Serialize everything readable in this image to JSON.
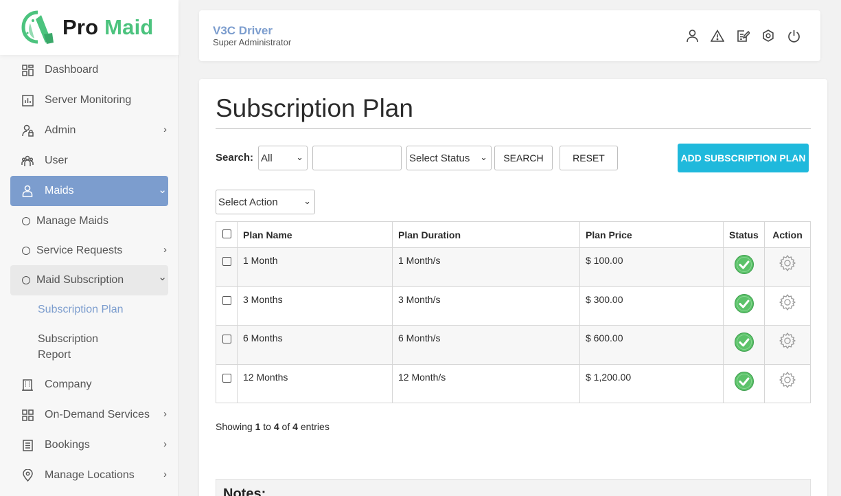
{
  "brand": {
    "word1": "Pro",
    "word2": "Maid"
  },
  "sidebar": {
    "items": [
      {
        "label": "Dashboard"
      },
      {
        "label": "Server Monitoring"
      },
      {
        "label": "Admin"
      },
      {
        "label": "User"
      },
      {
        "label": "Maids"
      },
      {
        "label": "Manage Maids"
      },
      {
        "label": "Service Requests"
      },
      {
        "label": "Maid Subscription"
      },
      {
        "label": "Subscription Plan"
      },
      {
        "label": "Subscription"
      },
      {
        "label": "Report"
      },
      {
        "label": "Company"
      },
      {
        "label": "On-Demand Services"
      },
      {
        "label": "Bookings"
      },
      {
        "label": "Manage Locations"
      }
    ]
  },
  "header": {
    "name": "V3C Driver",
    "role": "Super Administrator"
  },
  "page": {
    "title": "Subscription Plan"
  },
  "filters": {
    "search_label": "Search:",
    "field_select": "All",
    "search_value": "",
    "status_select": "Select Status",
    "search_button": "SEARCH",
    "reset_button": "RESET",
    "add_button": "ADD SUBSCRIPTION PLAN",
    "action_select": "Select Action"
  },
  "table": {
    "headers": [
      "Plan Name",
      "Plan Duration",
      "Plan Price",
      "Status",
      "Action"
    ],
    "rows": [
      {
        "name": "1 Month",
        "duration": "1 Month/s",
        "price": "$ 100.00"
      },
      {
        "name": "3 Months",
        "duration": "3 Month/s",
        "price": "$ 300.00"
      },
      {
        "name": "6 Months",
        "duration": "6 Month/s",
        "price": "$ 600.00"
      },
      {
        "name": "12 Months",
        "duration": "12 Month/s",
        "price": "$ 1,200.00"
      }
    ]
  },
  "footer": {
    "showing_prefix": "Showing",
    "from": "1",
    "to_word": "to",
    "to": "4",
    "of_word": "of",
    "total": "4",
    "suffix": "entries"
  },
  "notes": {
    "title": "Notes:"
  },
  "colors": {
    "accent": "#7c9dce",
    "brand_green": "#4cc37e",
    "add_button": "#1fb9dc",
    "status_green": "#5cc26a"
  }
}
